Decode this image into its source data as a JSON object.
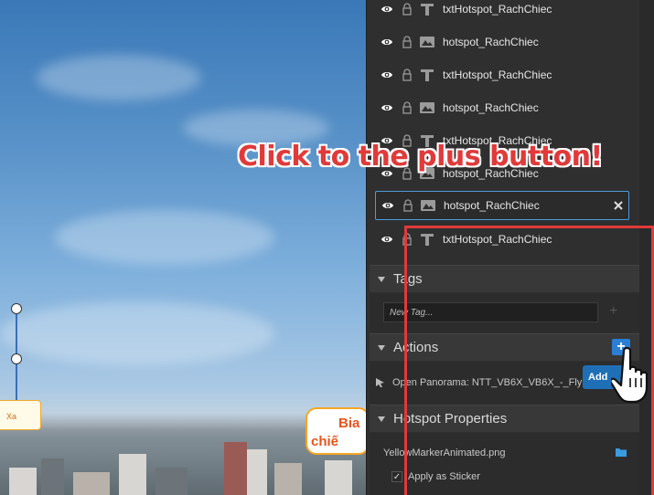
{
  "viewport": {
    "hotspot_label": "Xa",
    "badge_text_line1": "Bia",
    "badge_text_line2": "chiế"
  },
  "layers": [
    {
      "type": "text",
      "name": "txtHotspot_RachChiec"
    },
    {
      "type": "image",
      "name": "hotspot_RachChiec"
    },
    {
      "type": "text",
      "name": "txtHotspot_RachChiec"
    },
    {
      "type": "image",
      "name": "hotspot_RachChiec"
    },
    {
      "type": "text",
      "name": "txtHotspot_RachChiec"
    },
    {
      "type": "image",
      "name": "hotspot_RachChiec"
    },
    {
      "type": "image",
      "name": "hotspot_RachChiec",
      "selected": true
    },
    {
      "type": "text",
      "name": "txtHotspot_RachChiec"
    }
  ],
  "sections": {
    "tags": {
      "title": "Tags",
      "placeholder": "New Tag..."
    },
    "actions": {
      "title": "Actions",
      "action_label": "Open Panorama: NTT_VB6X_VB6X_-_Fly",
      "add_button": "Add"
    },
    "hotspot_properties": {
      "title": "Hotspot Properties",
      "file": "YellowMarkerAnimated.png",
      "apply_sticker": "Apply as Sticker"
    }
  },
  "annotation": "Click to the plus button!",
  "colors": {
    "panel_bg": "#2f2f2f",
    "accent_blue": "#2a7fd4",
    "annotation_red": "#e03a3a"
  }
}
